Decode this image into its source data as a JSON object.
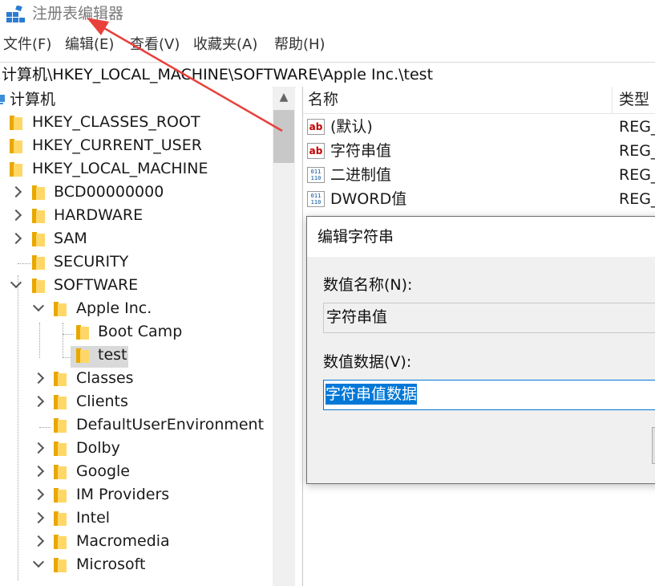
{
  "window": {
    "title": "注册表编辑器"
  },
  "menu": [
    "文件(F)",
    "编辑(E)",
    "查看(V)",
    "收藏夹(A)",
    "帮助(H)"
  ],
  "address": "计算机\\HKEY_LOCAL_MACHINE\\SOFTWARE\\Apple Inc.\\test",
  "tree": {
    "root": "计算机",
    "items": [
      {
        "label": "HKEY_CLASSES_ROOT"
      },
      {
        "label": "HKEY_CURRENT_USER"
      },
      {
        "label": "HKEY_LOCAL_MACHINE"
      },
      {
        "label": "BCD00000000"
      },
      {
        "label": "HARDWARE"
      },
      {
        "label": "SAM"
      },
      {
        "label": "SECURITY"
      },
      {
        "label": "SOFTWARE"
      },
      {
        "label": "Apple Inc."
      },
      {
        "label": "Boot Camp"
      },
      {
        "label": "test"
      },
      {
        "label": "Classes"
      },
      {
        "label": "Clients"
      },
      {
        "label": "DefaultUserEnvironment"
      },
      {
        "label": "Dolby"
      },
      {
        "label": "Google"
      },
      {
        "label": "IM Providers"
      },
      {
        "label": "Intel"
      },
      {
        "label": "Macromedia"
      },
      {
        "label": "Microsoft"
      }
    ],
    "selected": "test"
  },
  "list": {
    "columns": {
      "name": "名称",
      "type": "类型"
    },
    "rows": [
      {
        "icon": "string-value-icon",
        "icon_text": "ab",
        "name": "(默认)",
        "type": "REG_"
      },
      {
        "icon": "string-value-icon",
        "icon_text": "ab",
        "name": "字符串值",
        "type": "REG_"
      },
      {
        "icon": "binary-value-icon",
        "icon_text": "011 110",
        "name": "二进制值",
        "type": "REG_"
      },
      {
        "icon": "binary-value-icon",
        "icon_text": "011 110",
        "name": "DWORD值",
        "type": "REG_"
      }
    ]
  },
  "dialog": {
    "title": "编辑字符串",
    "name_label": "数值名称(N):",
    "name_value": "字符串值",
    "data_label": "数值数据(V):",
    "data_value": "字符串值数据"
  },
  "colors": {
    "annotation_arrow": "#e8413c",
    "selection": "#0078d7"
  }
}
